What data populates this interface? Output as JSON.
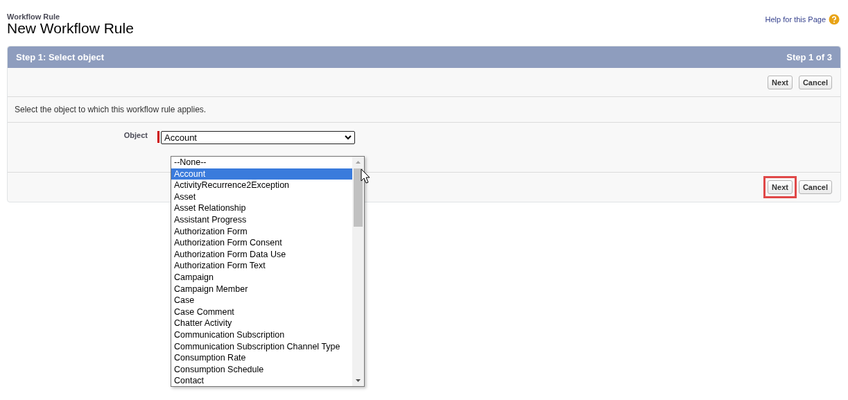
{
  "page": {
    "breadcrumb": "Workflow Rule",
    "title": "New Workflow Rule",
    "help_link": "Help for this Page"
  },
  "wizard": {
    "step_title": "Step 1: Select object",
    "step_count": "Step 1 of 3",
    "top_buttons": [
      {
        "label": "Next",
        "highlighted": false
      },
      {
        "label": "Cancel",
        "highlighted": false
      }
    ],
    "instruction": "Select the object to which this workflow rule applies.",
    "field": {
      "label": "Object",
      "required": true,
      "value": "Account",
      "expanded": true
    },
    "bottom_buttons": [
      {
        "label": "Next",
        "highlighted": true
      },
      {
        "label": "Cancel",
        "highlighted": false
      }
    ]
  },
  "dropdown_options": [
    {
      "label": "--None--",
      "selected": false
    },
    {
      "label": "Account",
      "selected": true
    },
    {
      "label": "ActivityRecurrence2Exception",
      "selected": false
    },
    {
      "label": "Asset",
      "selected": false
    },
    {
      "label": "Asset Relationship",
      "selected": false
    },
    {
      "label": "Assistant Progress",
      "selected": false
    },
    {
      "label": "Authorization Form",
      "selected": false
    },
    {
      "label": "Authorization Form Consent",
      "selected": false
    },
    {
      "label": "Authorization Form Data Use",
      "selected": false
    },
    {
      "label": "Authorization Form Text",
      "selected": false
    },
    {
      "label": "Campaign",
      "selected": false
    },
    {
      "label": "Campaign Member",
      "selected": false
    },
    {
      "label": "Case",
      "selected": false
    },
    {
      "label": "Case Comment",
      "selected": false
    },
    {
      "label": "Chatter Activity",
      "selected": false
    },
    {
      "label": "Communication Subscription",
      "selected": false
    },
    {
      "label": "Communication Subscription Channel Type",
      "selected": false
    },
    {
      "label": "Consumption Rate",
      "selected": false
    },
    {
      "label": "Consumption Schedule",
      "selected": false
    },
    {
      "label": "Contact",
      "selected": false
    }
  ]
}
